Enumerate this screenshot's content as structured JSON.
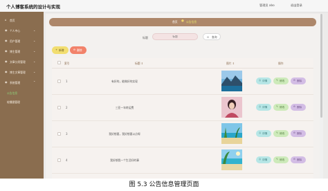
{
  "header": {
    "title": "个人博客系统的设计与实现",
    "admin_label": "管理员 abo",
    "logout_label": "退出登录"
  },
  "sidebar": {
    "items": [
      {
        "label": "首页",
        "icon": "home-icon",
        "glyph": "⌂",
        "arrow": false
      },
      {
        "label": "个人中心",
        "icon": "user-icon",
        "glyph": "◉",
        "arrow": true
      },
      {
        "label": "用户管理",
        "icon": "users-icon",
        "glyph": "◉",
        "arrow": true
      },
      {
        "label": "博主管理",
        "icon": "blogger-icon",
        "glyph": "◉",
        "arrow": true
      },
      {
        "label": "文章分类管理",
        "icon": "category-icon",
        "glyph": "◉",
        "arrow": true
      },
      {
        "label": "博主文章管理",
        "icon": "article-icon",
        "glyph": "◉",
        "arrow": true
      },
      {
        "label": "系统管理",
        "icon": "system-icon",
        "glyph": "◉",
        "arrow": true
      },
      {
        "label": "公告信息",
        "sub": true,
        "active": true
      },
      {
        "label": "轮播图管理",
        "sub": true,
        "active": false
      }
    ]
  },
  "breadcrumb": {
    "home": "首页",
    "separator": "●",
    "current": "公告信息"
  },
  "search": {
    "label": "标题",
    "placeholder": "标题",
    "button_label": "查询",
    "button_icon": "⊙"
  },
  "actions": {
    "add_label": "新增",
    "add_icon": "+",
    "delete_label": "删除",
    "delete_icon": "⊖"
  },
  "table": {
    "columns": [
      "索引",
      "标题 ⇕",
      "图片 ⇕",
      "操作"
    ],
    "rows": [
      {
        "index": "1",
        "title": "有好的，能做好的实现",
        "image": "lake-mountain-photo"
      },
      {
        "index": "2",
        "title": "三亚一年转运费",
        "image": "pink-portrait-photo"
      },
      {
        "index": "3",
        "title": "我好想要，我好想要以点呀",
        "image": "beach-photo"
      },
      {
        "index": "4",
        "title": "我好想我一个生活好的事",
        "image": "tropical-photo"
      }
    ],
    "row_actions": {
      "detail": "详情",
      "edit": "修改",
      "remove": "删除",
      "detail_icon": "◎",
      "edit_icon": "✎",
      "remove_icon": "⊖"
    }
  },
  "caption": "图 5.3  公告信息管理页面",
  "colors": {
    "sidebar": "#8a6d4f",
    "tab_strip": "#ad876a",
    "add": "#f2de70",
    "delete": "#f2826a",
    "detail": "#b6e6e6",
    "edit": "#cdeaba",
    "remove": "#d3bde5"
  }
}
